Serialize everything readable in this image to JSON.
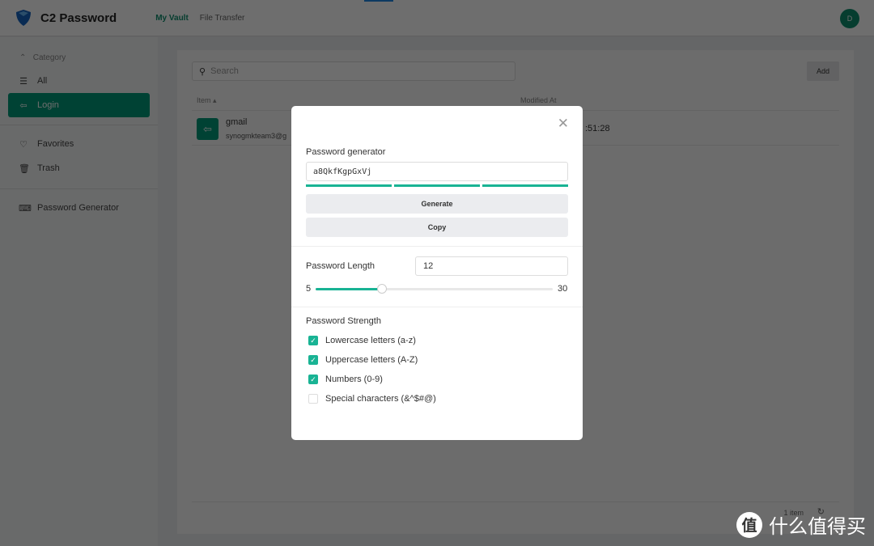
{
  "header": {
    "brand": "C2 Password",
    "nav": [
      "My Vault",
      "File Transfer"
    ],
    "avatar": "D"
  },
  "sidebar": {
    "category": "Category",
    "items": [
      {
        "label": "All",
        "icon": "list-icon"
      },
      {
        "label": "Login",
        "icon": "login-icon",
        "active": true
      },
      {
        "label": "Favorites",
        "icon": "heart-icon"
      },
      {
        "label": "Trash",
        "icon": "trash-icon"
      },
      {
        "label": "Password Generator",
        "icon": "password-generator-icon"
      }
    ]
  },
  "main": {
    "search_placeholder": "Search",
    "add_label": "Add",
    "columns": [
      "Item",
      "Modified At"
    ],
    "rows": [
      {
        "title": "gmail",
        "subtitle": "synogmkteam3@g",
        "modified": ":51:28"
      }
    ],
    "footer": "1 item"
  },
  "modal": {
    "title": "Password generator",
    "password": "a8QkfKgpGxVj",
    "strength_bars": 3,
    "generate": "Generate",
    "copy": "Copy",
    "length_label": "Password Length",
    "length": "12",
    "min": "5",
    "max": "30",
    "strength_label": "Password Strength",
    "options": [
      {
        "label": "Lowercase letters (a-z)",
        "checked": true
      },
      {
        "label": "Uppercase letters (A-Z)",
        "checked": true
      },
      {
        "label": "Numbers (0-9)",
        "checked": true
      },
      {
        "label": "Special characters (&^$#@)",
        "checked": false
      }
    ]
  },
  "colors": {
    "accent": "#00997a",
    "check": "#19b394"
  },
  "watermark": {
    "badge": "值",
    "text": "什么值得买"
  }
}
